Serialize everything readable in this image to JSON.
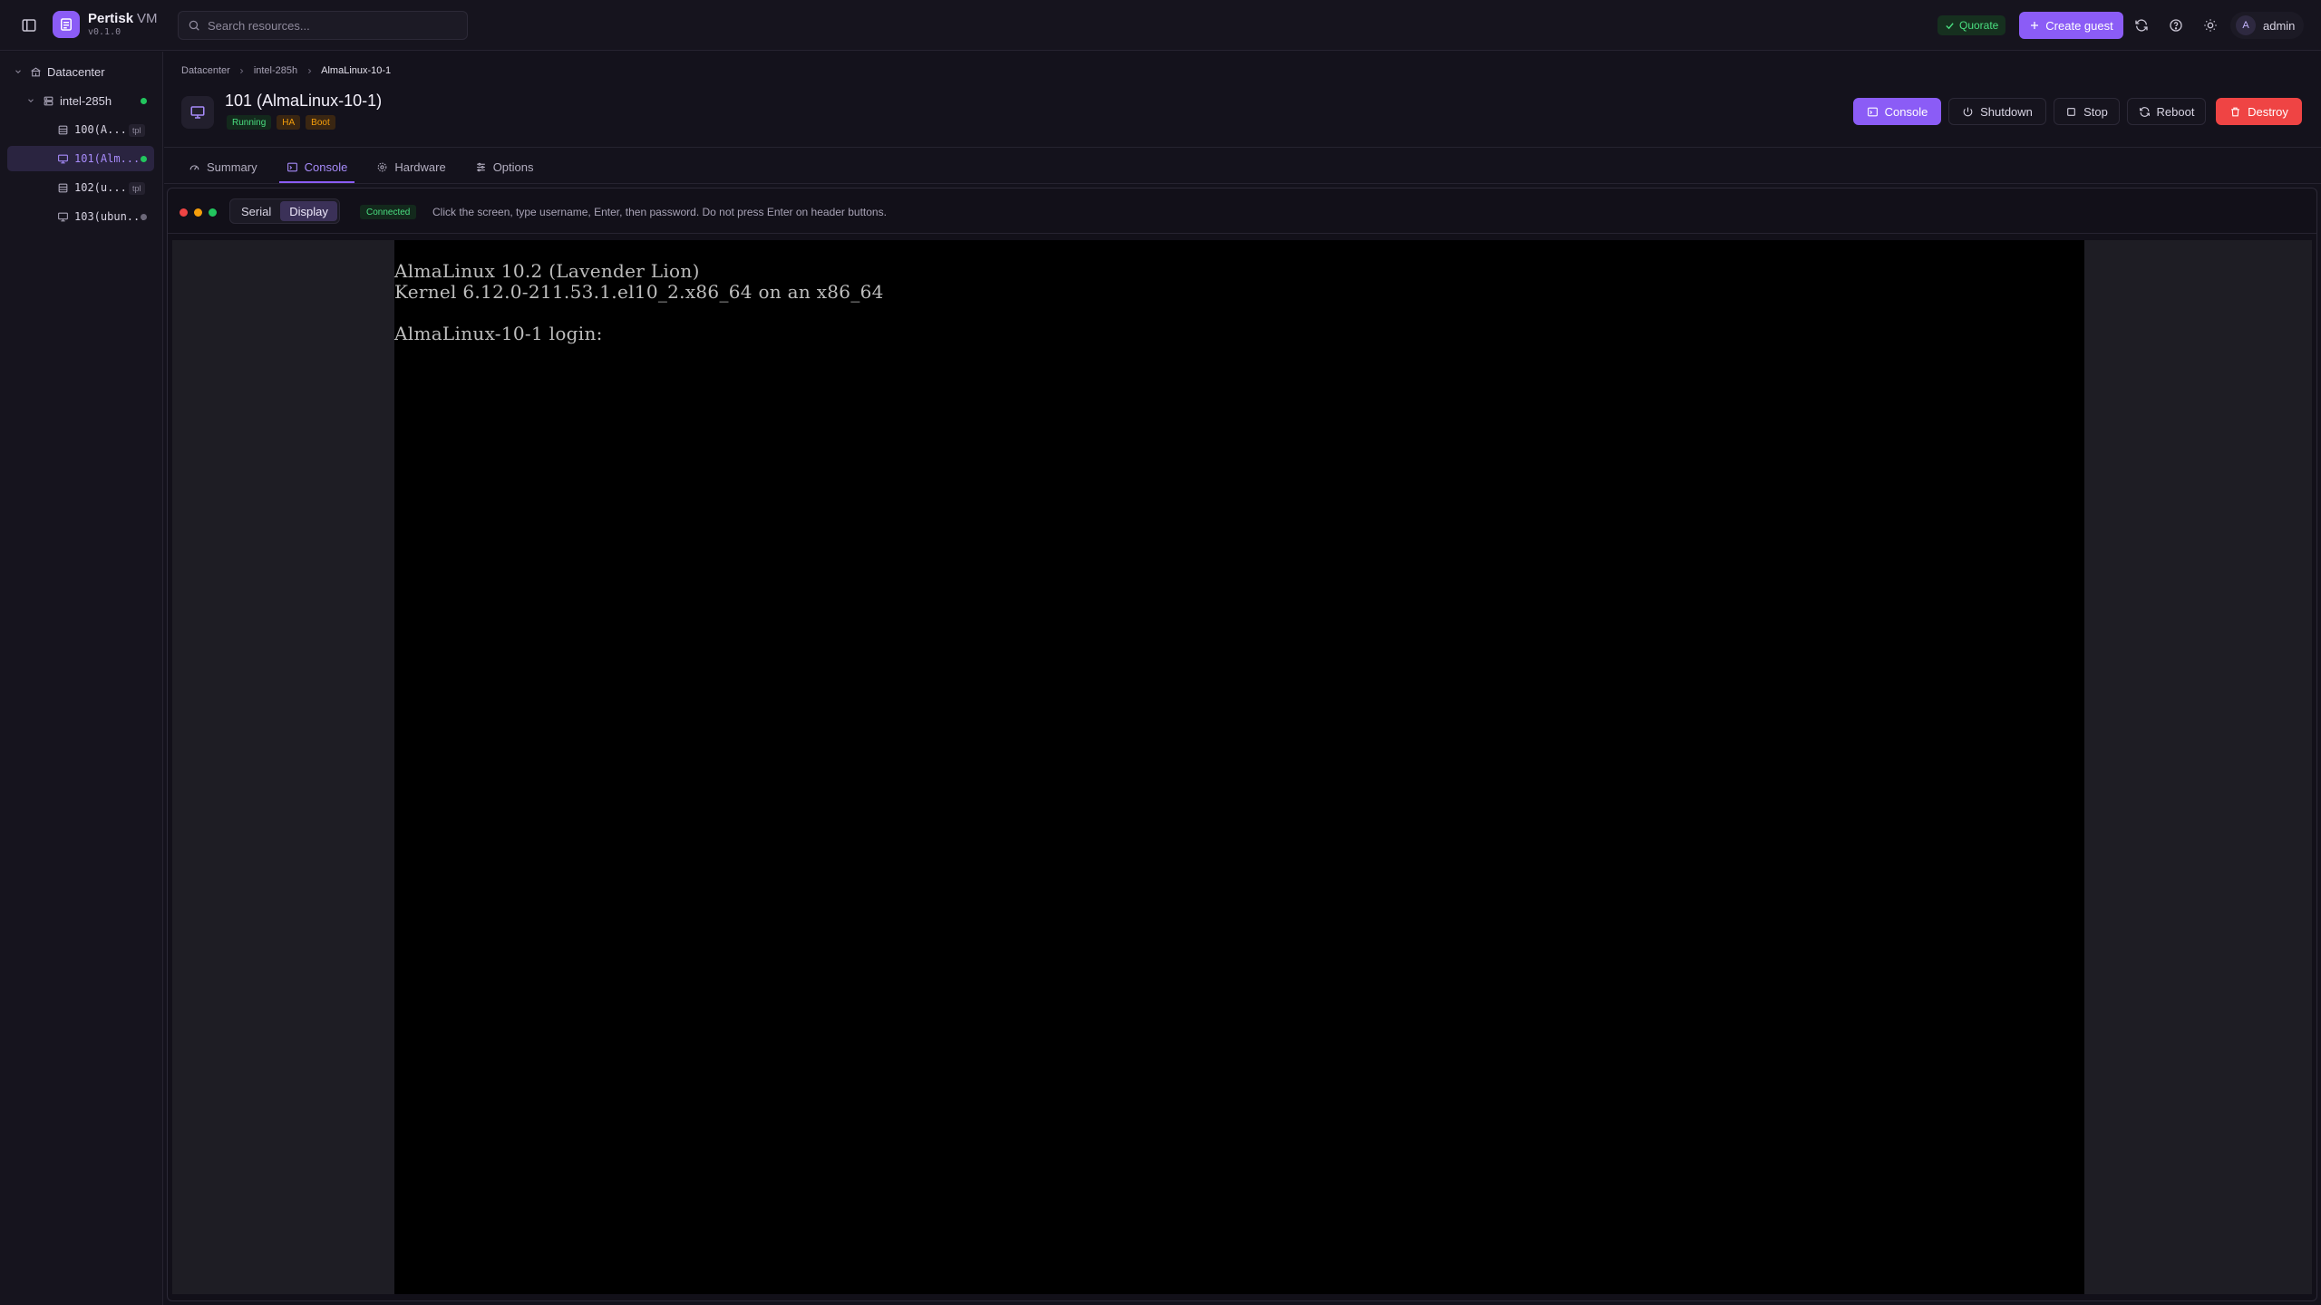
{
  "app": {
    "name": "Pertisk",
    "name_suffix": "VM",
    "version": "v0.1.0"
  },
  "search": {
    "placeholder": "Search resources...",
    "value": ""
  },
  "topbar": {
    "quorate_label": "Quorate",
    "create_guest_label": "Create guest",
    "user_initial": "A",
    "user_name": "admin"
  },
  "sidebar": {
    "datacenter_label": "Datacenter",
    "node": {
      "label": "intel-285h",
      "status": "online"
    },
    "guests": [
      {
        "label": "100(A...",
        "badge": "tpl",
        "icon": "template-icon"
      },
      {
        "label": "101(Alm...",
        "status": "running",
        "icon": "monitor-icon",
        "selected": true
      },
      {
        "label": "102(u...",
        "badge": "tpl",
        "icon": "template-icon"
      },
      {
        "label": "103(ubun...",
        "status": "stopped",
        "icon": "monitor-icon"
      }
    ]
  },
  "breadcrumb": [
    "Datacenter",
    "intel-285h",
    "AlmaLinux-10-1"
  ],
  "vm": {
    "title": "101 (AlmaLinux-10-1)",
    "badges": [
      "Running",
      "HA",
      "Boot"
    ]
  },
  "actions": {
    "console": "Console",
    "shutdown": "Shutdown",
    "stop": "Stop",
    "reboot": "Reboot",
    "destroy": "Destroy"
  },
  "tabs": [
    {
      "label": "Summary",
      "active": false
    },
    {
      "label": "Console",
      "active": true
    },
    {
      "label": "Hardware",
      "active": false
    },
    {
      "label": "Options",
      "active": false
    }
  ],
  "console": {
    "modes": [
      "Serial",
      "Display"
    ],
    "active_mode": "Display",
    "status": "Connected",
    "hint": "Click the screen, type username, Enter, then password. Do not press Enter on header buttons.",
    "screen_lines": [
      "AlmaLinux 10.2 (Lavender Lion)",
      "Kernel 6.12.0-211.53.1.el10_2.x86_64 on an x86_64",
      "",
      "AlmaLinux-10-1 login:"
    ]
  },
  "colors": {
    "accent": "#8b5cf6",
    "danger": "#ef4444",
    "success": "#22c55e",
    "warning": "#f59e0b",
    "background": "#14121c"
  }
}
